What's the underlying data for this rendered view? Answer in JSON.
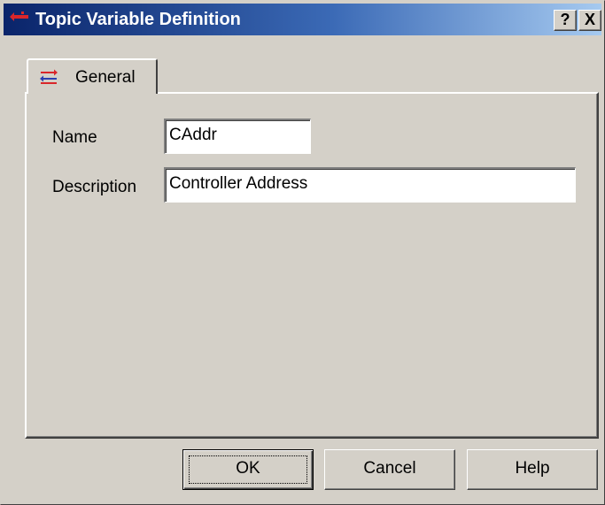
{
  "window": {
    "title": "Topic Variable Definition",
    "help_button": "?",
    "close_button": "X"
  },
  "tabs": [
    {
      "label": "General",
      "icon": "transfer-arrows-icon",
      "selected": true
    }
  ],
  "form": {
    "name_label": "Name",
    "name_value": "CAddr",
    "description_label": "Description",
    "description_value": "Controller Address"
  },
  "buttons": {
    "ok": "OK",
    "cancel": "Cancel",
    "help": "Help"
  },
  "colors": {
    "face": "#d4d0c8",
    "title_start": "#0a246a",
    "title_end": "#a6caf0",
    "icon_red": "#d9262a",
    "icon_blue": "#2a3fb0"
  }
}
